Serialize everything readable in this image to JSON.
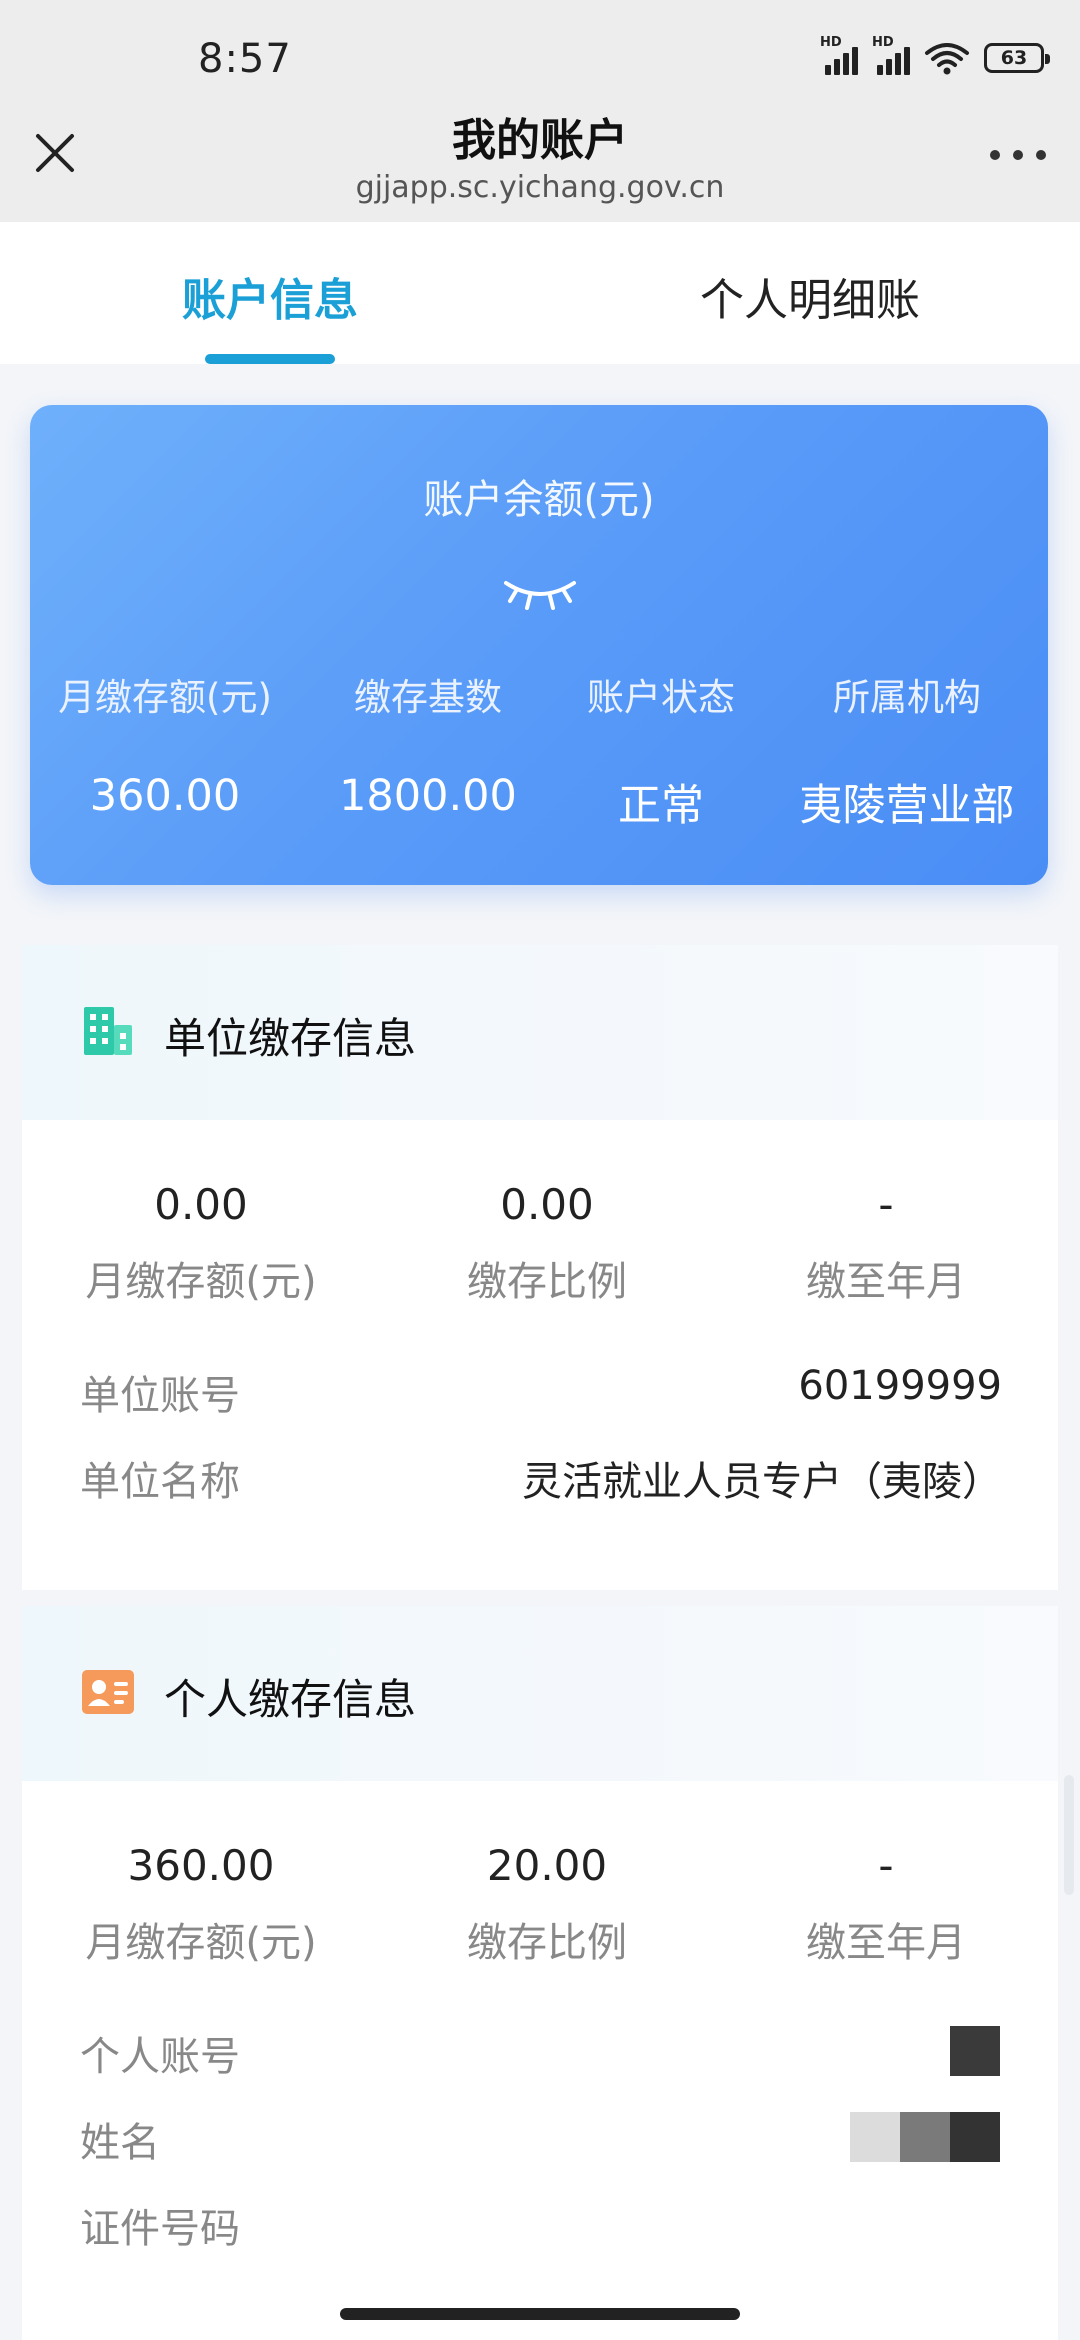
{
  "status_bar": {
    "time": "8:57",
    "signal1_tag": "HD",
    "signal2_tag": "HD",
    "battery": "63"
  },
  "title_bar": {
    "close_icon": "close-icon",
    "title": "我的账户",
    "url": "gjjapp.sc.yichang.gov.cn",
    "more_icon": "more-dots-icon"
  },
  "tabs": [
    {
      "label": "账户信息",
      "active": true
    },
    {
      "label": "个人明细账",
      "active": false
    }
  ],
  "balance_card": {
    "label": "账户余额(元)",
    "visibility_icon": "eye-closed-icon",
    "stats": [
      {
        "label": "月缴存额(元)",
        "value": "360.00"
      },
      {
        "label": "缴存基数",
        "value": "1800.00"
      },
      {
        "label": "账户状态",
        "value": "正常"
      },
      {
        "label": "所属机构",
        "value": "夷陵营业部"
      }
    ]
  },
  "unit_section": {
    "icon": "building-icon",
    "title": "单位缴存信息",
    "stats": [
      {
        "value": "0.00",
        "label": "月缴存额(元)"
      },
      {
        "value": "0.00",
        "label": "缴存比例"
      },
      {
        "value": "-",
        "label": "缴至年月"
      }
    ],
    "rows": [
      {
        "label": "单位账号",
        "value": "60199999"
      },
      {
        "label": "单位名称",
        "value": "灵活就业人员专户（夷陵）"
      }
    ]
  },
  "personal_section": {
    "icon": "id-card-icon",
    "title": "个人缴存信息",
    "stats": [
      {
        "value": "360.00",
        "label": "月缴存额(元)"
      },
      {
        "value": "20.00",
        "label": "缴存比例"
      },
      {
        "value": "-",
        "label": "缴至年月"
      }
    ],
    "rows": [
      {
        "label": "个人账号"
      },
      {
        "label": "姓名"
      },
      {
        "label": "证件号码"
      }
    ]
  },
  "colors": {
    "accent": "#1a9fd6",
    "card_gradient_start": "#6fb0fb",
    "card_gradient_end": "#4a8df5",
    "building_icon": "#2dc9a8",
    "person_icon": "#f59a5b"
  }
}
